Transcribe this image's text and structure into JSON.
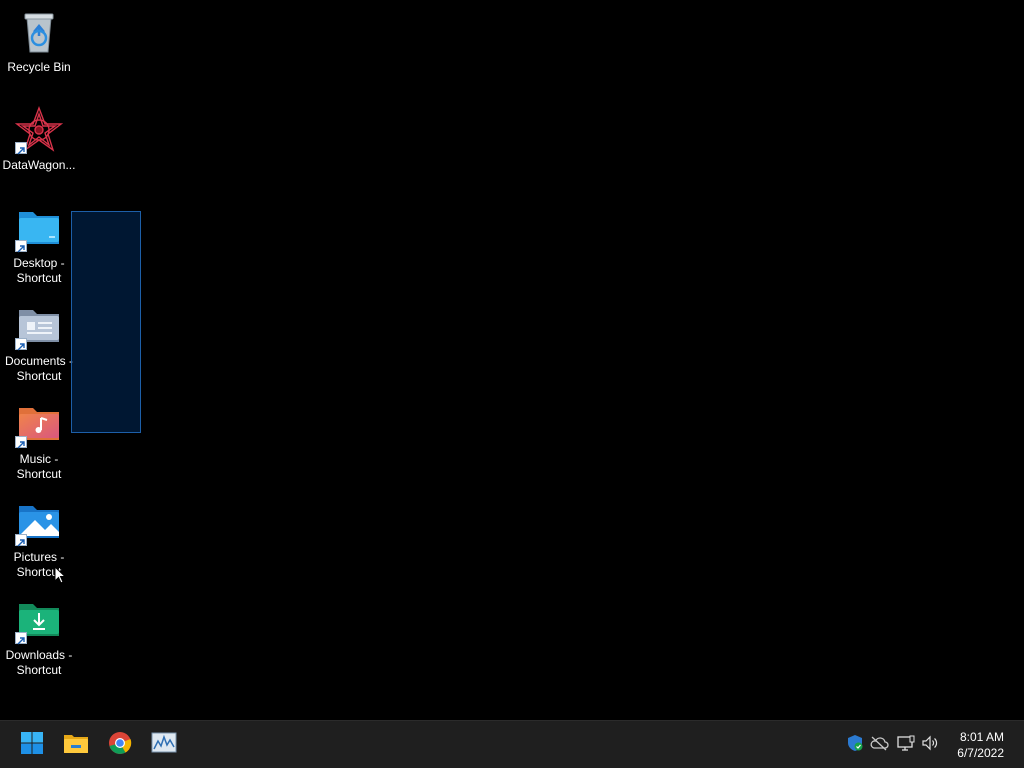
{
  "desktop": {
    "icons": [
      {
        "label": "Recycle Bin",
        "icon": "recycle-bin-icon",
        "shortcut": false
      },
      {
        "label": "DataWagon...",
        "icon": "datawagon-icon",
        "shortcut": true
      },
      {
        "label": "Desktop - Shortcut",
        "icon": "desktop-folder-icon",
        "shortcut": true
      },
      {
        "label": "Documents - Shortcut",
        "icon": "documents-folder-icon",
        "shortcut": true
      },
      {
        "label": "Music - Shortcut",
        "icon": "music-folder-icon",
        "shortcut": true
      },
      {
        "label": "Pictures - Shortcut",
        "icon": "pictures-folder-icon",
        "shortcut": true
      },
      {
        "label": "Downloads - Shortcut",
        "icon": "downloads-folder-icon",
        "shortcut": true
      }
    ],
    "background_color": "#000000",
    "selection_color": "#1d5fa8"
  },
  "taskbar": {
    "apps": [
      {
        "name": "start",
        "icon": "windows-start-icon"
      },
      {
        "name": "file-explorer",
        "icon": "file-explorer-icon"
      },
      {
        "name": "chrome",
        "icon": "chrome-icon"
      },
      {
        "name": "resource-monitor",
        "icon": "performance-monitor-icon"
      }
    ],
    "tray": [
      {
        "icon": "security-shield-icon"
      },
      {
        "icon": "onedrive-offline-icon"
      },
      {
        "icon": "network-icon"
      },
      {
        "icon": "volume-icon"
      }
    ],
    "clock": {
      "time": "8:01 AM",
      "date": "6/7/2022"
    },
    "background_color": "#1f1f1f"
  }
}
